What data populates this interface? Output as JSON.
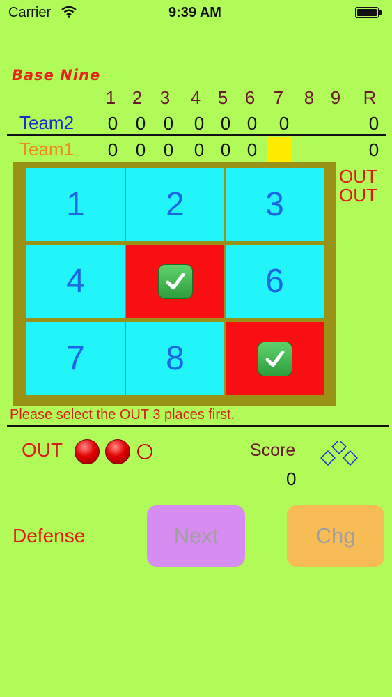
{
  "status_bar": {
    "carrier": "Carrier",
    "time": "9:39 AM"
  },
  "app": {
    "title": "Base Nine"
  },
  "scoreboard": {
    "innings": [
      "1",
      "2",
      "3",
      "4",
      "5",
      "6",
      "7",
      "8",
      "9"
    ],
    "runs_header": "R",
    "teams": [
      {
        "name": "Team2",
        "color": "#1a2bd0",
        "scores": [
          "0",
          "0",
          "0",
          "0",
          "0",
          "0",
          "0",
          "",
          ""
        ],
        "total": "0"
      },
      {
        "name": "Team1",
        "color": "#f08a1a",
        "scores": [
          "0",
          "0",
          "0",
          "0",
          "0",
          "0",
          "",
          "",
          ""
        ],
        "total": "0"
      }
    ],
    "current_inning_highlight": "#ffeb00"
  },
  "grid": {
    "cells": [
      {
        "label": "1",
        "state": "open"
      },
      {
        "label": "2",
        "state": "open"
      },
      {
        "label": "3",
        "state": "open"
      },
      {
        "label": "4",
        "state": "open"
      },
      {
        "label": "",
        "state": "out",
        "icon": "checkmark-icon"
      },
      {
        "label": "6",
        "state": "open"
      },
      {
        "label": "7",
        "state": "open"
      },
      {
        "label": "8",
        "state": "open"
      },
      {
        "label": "",
        "state": "out",
        "icon": "checkmark-icon"
      }
    ],
    "open_color": "#22f5fa",
    "out_color": "#f90f12"
  },
  "out_indicators": [
    "OUT",
    "OUT"
  ],
  "message": "Please select the OUT 3 places first.",
  "outs": {
    "label": "OUT",
    "count": 2,
    "max": 3
  },
  "score": {
    "label": "Score",
    "value": "0"
  },
  "mode_label": "Defense",
  "buttons": {
    "next": "Next",
    "change": "Chg"
  }
}
